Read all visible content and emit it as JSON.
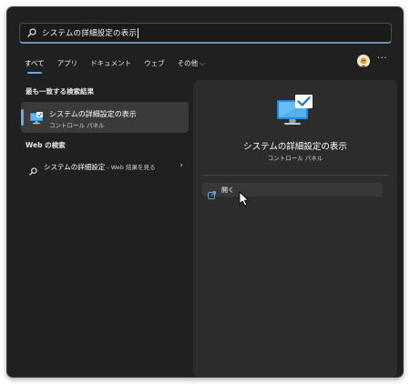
{
  "search": {
    "value": "システムの詳細設定の表示"
  },
  "tabs": [
    {
      "label": "すべて"
    },
    {
      "label": "アプリ"
    },
    {
      "label": "ドキュメント"
    },
    {
      "label": "ウェブ"
    },
    {
      "label": "その他"
    }
  ],
  "more_menu": {
    "label": "···"
  },
  "best_match": {
    "section_title": "最も一致する検索結果",
    "name": "システムの詳細設定の表示",
    "subtitle": "コントロール パネル"
  },
  "web_search": {
    "section_title": "Web の検索",
    "query": "システムの詳細設定",
    "suffix": " - Web 結果を見る"
  },
  "detail_panel": {
    "title": "システムの詳細設定の表示",
    "subtitle": "コントロール パネル",
    "actions": [
      {
        "label": "開く",
        "icon": "open-external-icon"
      }
    ]
  },
  "colors": {
    "accent": "#69a9f0",
    "background": "#202020",
    "panel": "#2c2c2c",
    "selected": "#3a3a3a"
  }
}
